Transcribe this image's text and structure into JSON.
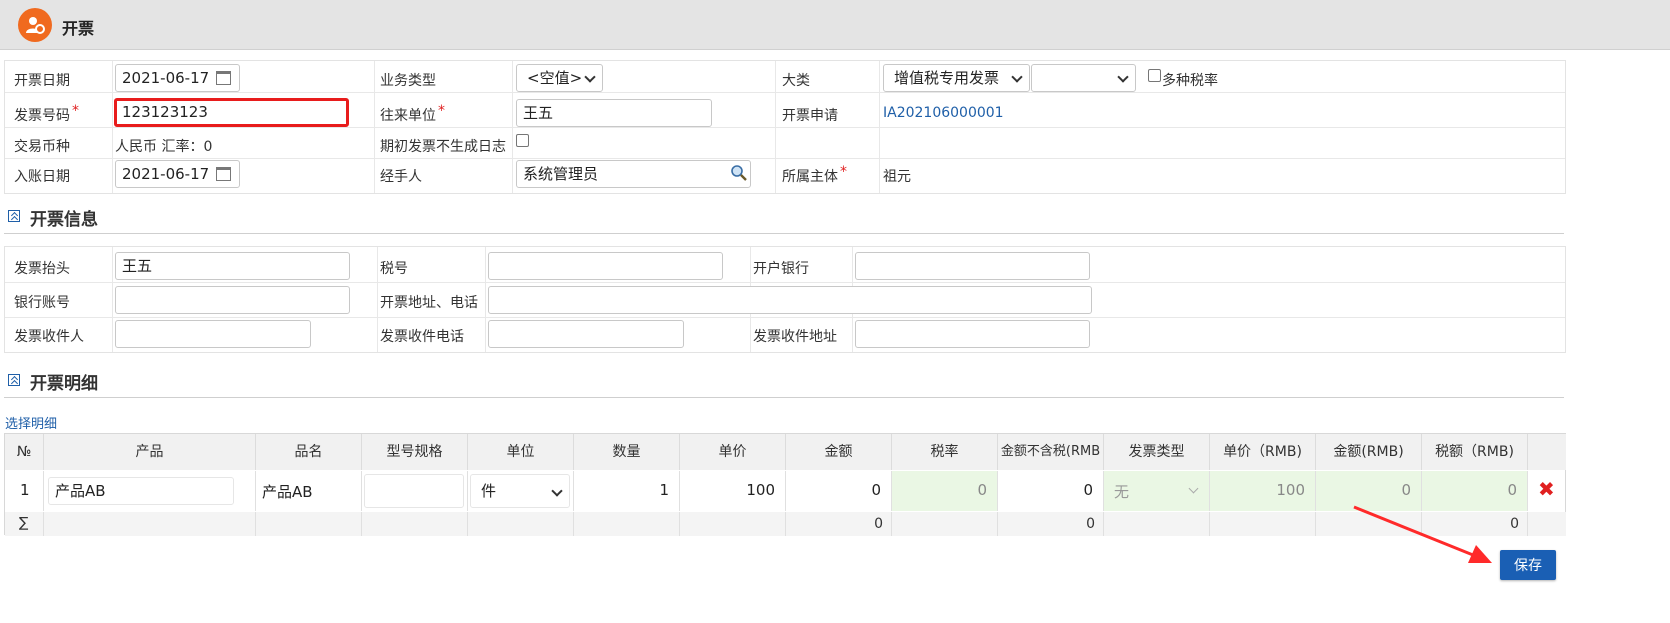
{
  "app": {
    "title": "开票",
    "accent": "#f06a1f"
  },
  "basic": {
    "invoice_date_label": "开票日期",
    "invoice_date": "2021-06-17",
    "business_type_label": "业务类型",
    "business_type": "<空值>",
    "category_label": "大类",
    "category": "增值税专用发票",
    "category2": "",
    "multi_tax_label": "多种税率",
    "invoice_no_label": "发票号码",
    "invoice_no": "123123123",
    "partner_label": "往来单位",
    "partner": "王五",
    "request_label": "开票申请",
    "request": "IA202106000001",
    "currency_label": "交易币种",
    "currency": "人民币 汇率：0",
    "no_log_label": "期初发票不生成日志",
    "post_date_label": "入账日期",
    "post_date": "2021-06-17",
    "handler_label": "经手人",
    "handler": "系统管理员",
    "entity_label": "所属主体",
    "entity": "祖元",
    "required_mark": "*"
  },
  "info": {
    "section_title": "开票信息",
    "header_label": "发票抬头",
    "header": "王五",
    "tax_no_label": "税号",
    "tax_no": "",
    "bank_label": "开户银行",
    "bank": "",
    "account_label": "银行账号",
    "account": "",
    "address_label": "开票地址、电话",
    "address": "",
    "recipient_label": "发票收件人",
    "recipient": "",
    "recipient_phone_label": "发票收件电话",
    "recipient_phone": "",
    "recipient_addr_label": "发票收件地址",
    "recipient_addr": ""
  },
  "detail": {
    "section_title": "开票明细",
    "select_link": "选择明细",
    "columns": [
      "№",
      "产品",
      "品名",
      "型号规格",
      "单位",
      "数量",
      "单价",
      "金额",
      "税率",
      "金额不含税(RMB",
      "发票类型",
      "单价（RMB)",
      "金额(RMB)",
      "税额（RMB)"
    ],
    "row": {
      "no": "1",
      "product": "产品AB",
      "name": "产品AB",
      "spec": "",
      "unit": "件",
      "qty": "1",
      "price": "100",
      "amount": "0",
      "tax_rate": "0",
      "amount_ex_tax": "0",
      "invoice_type": "无",
      "price_rmb": "100",
      "amount_rmb": "0",
      "tax_rmb": "0"
    },
    "sum": {
      "symbol": "∑",
      "amount": "0",
      "amount_ex_tax": "0",
      "tax_rmb": "0"
    }
  },
  "actions": {
    "save": "保存"
  }
}
